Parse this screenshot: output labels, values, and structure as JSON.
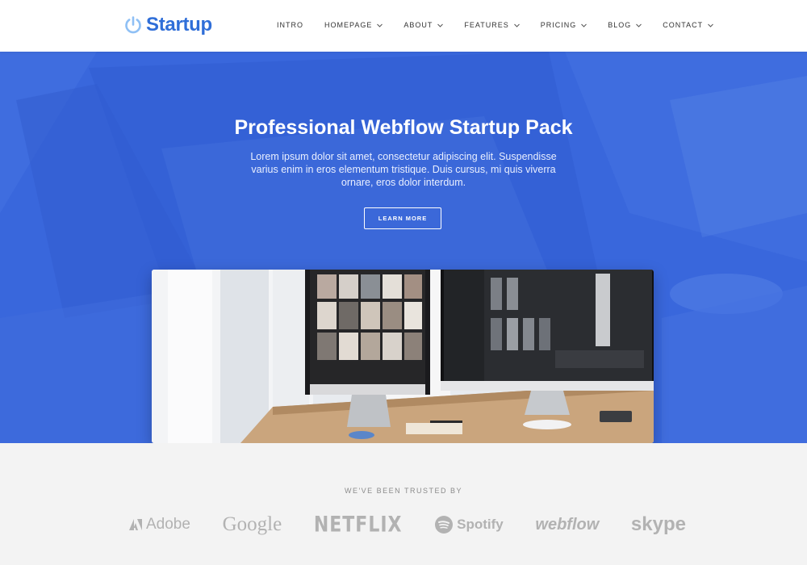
{
  "brand": {
    "name": "Startup",
    "icon": "power-icon",
    "color": "#2f6ed8"
  },
  "nav": {
    "items": [
      {
        "label": "INTRO",
        "dropdown": false
      },
      {
        "label": "HOMEPAGE",
        "dropdown": true
      },
      {
        "label": "ABOUT",
        "dropdown": true
      },
      {
        "label": "FEATURES",
        "dropdown": true
      },
      {
        "label": "PRICING",
        "dropdown": true
      },
      {
        "label": "BLOG",
        "dropdown": true
      },
      {
        "label": "CONTACT",
        "dropdown": true
      }
    ]
  },
  "hero": {
    "title": "Professional Webflow Startup Pack",
    "text": "Lorem ipsum dolor sit amet, consectetur adipiscing elit. Suspendisse varius enim in eros elementum tristique. Duis cursus, mi quis viverra ornare, eros dolor interdum.",
    "cta": "LEARN MORE",
    "accent": "#3a68dc"
  },
  "trusted": {
    "title": "WE'VE BEEN TRUSTED BY",
    "logos": [
      "Adobe",
      "Google",
      "NETFLIX",
      "Spotify",
      "webflow",
      "skype"
    ]
  }
}
